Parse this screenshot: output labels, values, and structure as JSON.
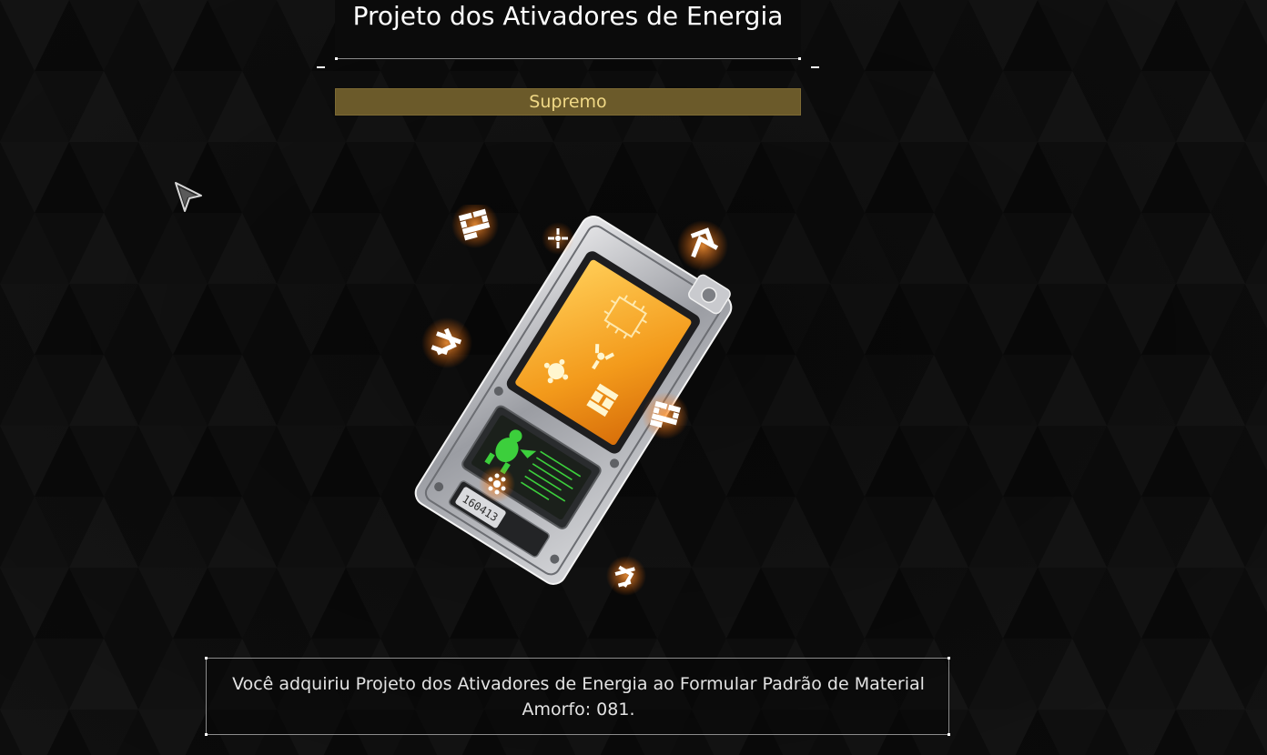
{
  "item": {
    "title": "Projeto dos Ativadores de Energia",
    "rarity": "Supremo",
    "serial": "160413"
  },
  "message": {
    "text": "Você adquiriu Projeto dos Ativadores de Energia ao Formular Padrão de Material Amorfo: 081."
  },
  "colors": {
    "background": "#0b0b0b",
    "rarity_bg": "#6b5a2a",
    "rarity_text": "#f1d986",
    "glow": "#ff8a2a",
    "screen": "#f5a623",
    "panel_green": "#3ccf3c"
  },
  "icons": [
    "cursor-arrow-icon",
    "energy-glyph-icon",
    "arrow-glyph-icon",
    "spark-glyph-icon"
  ]
}
